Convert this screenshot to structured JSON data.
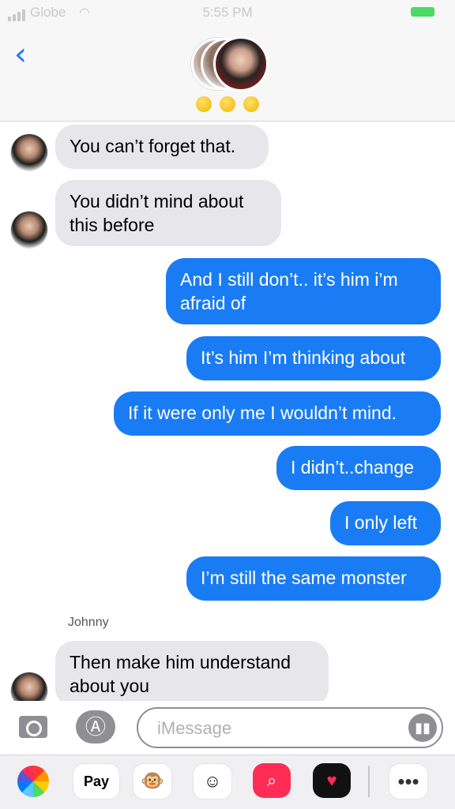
{
  "status_bar": {
    "carrier": "Globe",
    "time": "5:55 PM"
  },
  "header": {
    "back_icon": "chevron-left-icon",
    "emoji_count": 3,
    "emoji": "shushing-face-emoji"
  },
  "messages": [
    {
      "direction": "incoming",
      "text": "You can’t forget that."
    },
    {
      "direction": "incoming",
      "text": "You didn’t mind about\nthis before"
    },
    {
      "direction": "outgoing",
      "text": "And I still don’t.. it’s him i’m\nafraid of"
    },
    {
      "direction": "outgoing",
      "text": "It’s him I’m thinking about"
    },
    {
      "direction": "outgoing",
      "text": "If it were only me I wouldn’t mind."
    },
    {
      "direction": "outgoing",
      "text": "I didn’t..change"
    },
    {
      "direction": "outgoing",
      "text": "I only left"
    },
    {
      "direction": "outgoing",
      "text": "I’m still the same monster"
    },
    {
      "direction": "incoming",
      "sender": "Johnny",
      "text": "Then make him understand\nabout you"
    }
  ],
  "input_bar": {
    "placeholder": "iMessage",
    "camera_icon": "camera-icon",
    "appstore_icon": "app-store-icon",
    "audio_icon": "audio-waveform-icon"
  },
  "app_drawer": {
    "apple_pay_label": "Pay",
    "items": [
      "photos-icon",
      "apple-pay-icon",
      "animoji-icon",
      "memoji-icon",
      "search-images-icon",
      "digital-touch-icon",
      "more-icon"
    ]
  },
  "colors": {
    "outgoing_bubble": "#1a7cf5",
    "incoming_bubble": "#e6e6eb",
    "accent": "#1a7cf5",
    "battery": "#4cd964"
  }
}
